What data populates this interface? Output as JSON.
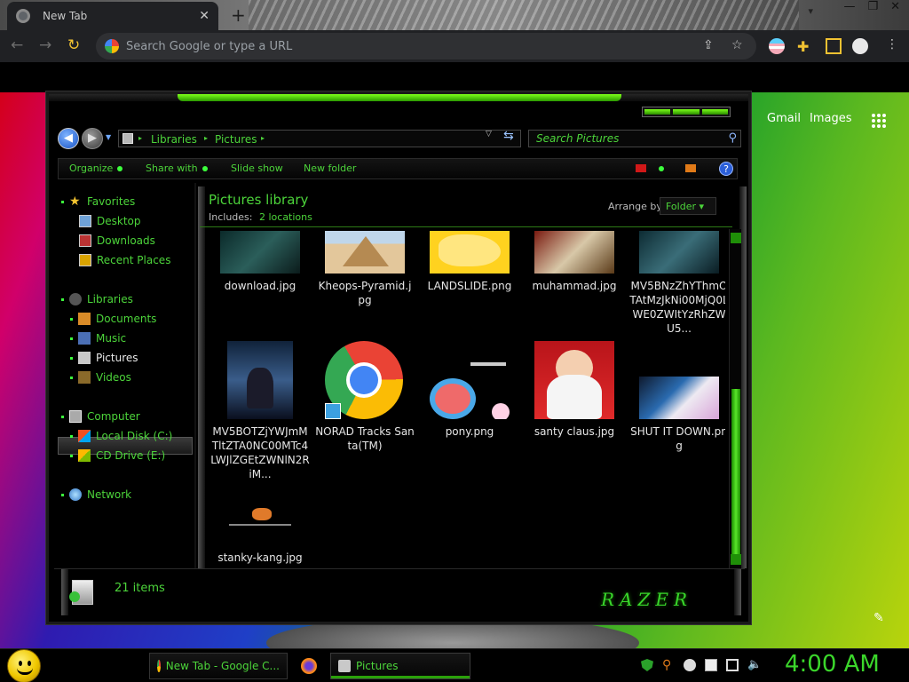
{
  "browser": {
    "tab_title": "New Tab",
    "tab_close": "✕",
    "new_tab": "+",
    "omnibox_placeholder": "Search Google or type a URL",
    "window_controls": [
      "▾",
      "—",
      "❐",
      "✕"
    ]
  },
  "google": {
    "gmail": "Gmail",
    "images": "Images"
  },
  "explorer": {
    "breadcrumbs": [
      "Libraries",
      "Pictures"
    ],
    "search_placeholder": "Search Pictures",
    "commands": [
      "Organize",
      "Share with",
      "Slide show",
      "New folder"
    ],
    "help": "?",
    "nav": {
      "favorites": "Favorites",
      "desktop": "Desktop",
      "downloads": "Downloads",
      "recent": "Recent Places",
      "libraries": "Libraries",
      "documents": "Documents",
      "music": "Music",
      "pictures": "Pictures",
      "videos": "Videos",
      "computer": "Computer",
      "local_disk": "Local Disk (C:)",
      "cd_drive": "CD Drive (E:)",
      "network": "Network"
    },
    "library": {
      "title": "Pictures library",
      "includes_label": "Includes:",
      "locations": "2 locations",
      "arrange_label": "Arrange by:",
      "arrange_value": "Folder ▾"
    },
    "files": [
      "download.jpg",
      "Kheops-Pyramid.jpg",
      "LANDSLIDE.png",
      "muhammad.jpg",
      "MV5BNzZhYThmOTAtMzJkNi00MjQ0LWE0ZWItYzRhZWU5...",
      "MV5BOTZjYWJmMTltZTA0NC00MTc4LWJlZGEtZWNlN2RiM...",
      "NORAD Tracks Santa(TM)",
      "pony.png",
      "santy claus.jpg",
      "SHUT IT DOWN.png",
      "stanky-kang.jpg"
    ],
    "item_count": "21 items",
    "brand": "RAZER"
  },
  "taskbar": {
    "chrome_task": "New Tab - Google C...",
    "pictures_task": "Pictures",
    "clock": "4:00 AM"
  }
}
